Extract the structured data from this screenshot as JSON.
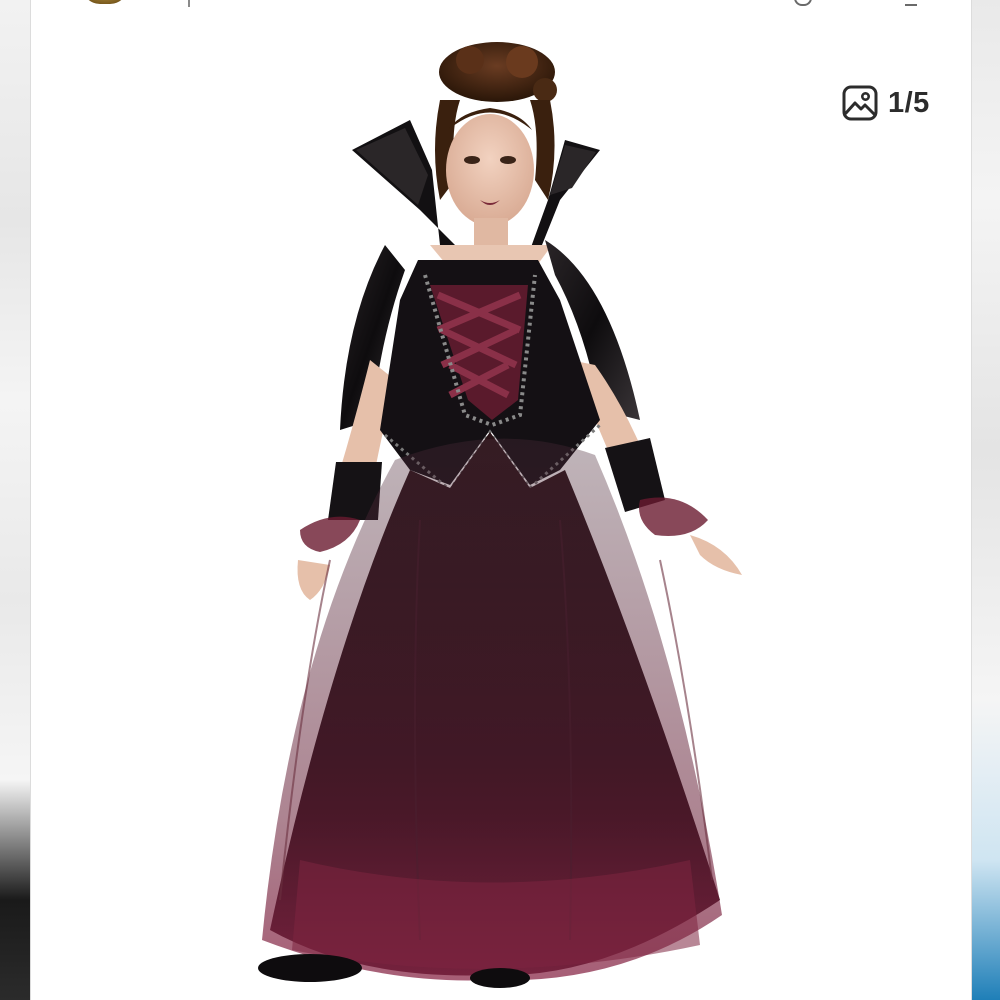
{
  "gallery": {
    "counter": {
      "current": 1,
      "total": 5,
      "label": "1/5",
      "icon": "image-gallery-icon"
    }
  },
  "colors": {
    "background": "#ffffff",
    "counter_text": "#2c2c2c",
    "dress_black": "#141014",
    "dress_burgundy": "#5a1a2c",
    "tulle_red": "#7e2440"
  }
}
